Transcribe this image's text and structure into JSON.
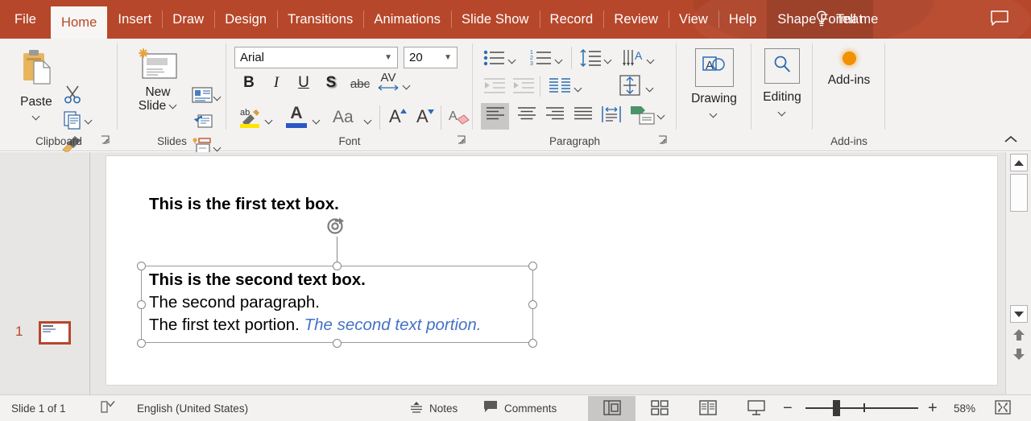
{
  "titlebar": {
    "tabs": [
      {
        "label": "File",
        "state": "file"
      },
      {
        "label": "Home",
        "state": "active"
      },
      {
        "label": "Insert",
        "state": "normal"
      },
      {
        "label": "Draw",
        "state": "normal"
      },
      {
        "label": "Design",
        "state": "normal"
      },
      {
        "label": "Transitions",
        "state": "normal"
      },
      {
        "label": "Animations",
        "state": "normal"
      },
      {
        "label": "Slide Show",
        "state": "normal"
      },
      {
        "label": "Record",
        "state": "normal"
      },
      {
        "label": "Review",
        "state": "normal"
      },
      {
        "label": "View",
        "state": "normal"
      },
      {
        "label": "Help",
        "state": "normal"
      },
      {
        "label": "Shape Format",
        "state": "contextual"
      }
    ],
    "tellme_label": "Tell me",
    "bulb_icon": "lightbulb-icon",
    "comments_icon": "comment-bubble-icon",
    "accent_color": "#b7472a"
  },
  "ribbon": {
    "groups": [
      {
        "name": "Clipboard",
        "title": "Clipboard"
      },
      {
        "name": "Slides",
        "title": "Slides"
      },
      {
        "name": "Font",
        "title": "Font"
      },
      {
        "name": "Paragraph",
        "title": "Paragraph"
      },
      {
        "name": "Drawing",
        "title": "Drawing"
      },
      {
        "name": "Editing",
        "title": "Editing"
      },
      {
        "name": "Add-ins",
        "title": "Add-ins"
      }
    ],
    "clipboard": {
      "paste_label": "Paste",
      "cut_icon": "scissors-icon",
      "copy_icon": "copy-icon",
      "format_painter_icon": "format-painter-icon"
    },
    "slides": {
      "new_slide_label": "New\nSlide",
      "new_slide_line1": "New",
      "new_slide_line2": "Slide",
      "layout_icon": "slide-layout-icon",
      "reset_icon": "reset-slide-icon",
      "section_icon": "section-icon"
    },
    "font": {
      "font_name": "Arial",
      "font_size": "20",
      "bold_label": "B",
      "italic_label": "I",
      "underline_label": "U",
      "shadow_label": "S",
      "strike_label": "abc",
      "spacing_label": "AV",
      "highlight_label": "ab",
      "fontcolor_label": "A",
      "changecase_label": "Aa",
      "grow_label": "A",
      "shrink_label": "A",
      "clearformat_label": "A"
    },
    "paragraph": {
      "bullets_icon": "bulleted-list-icon",
      "numbering_icon": "numbered-list-icon",
      "linespacing_icon": "line-spacing-icon",
      "textdirection_icon": "text-direction-icon",
      "decrease_indent_icon": "decrease-indent-icon",
      "increase_indent_icon": "increase-indent-icon",
      "columns_icon": "columns-icon",
      "align_text_icon": "align-text-vertical-icon",
      "align_left_icon": "align-left-icon",
      "align_center_icon": "align-center-icon",
      "align_right_icon": "align-right-icon",
      "justify_icon": "justify-icon",
      "text_fit_icon": "text-fit-icon",
      "smartart_icon": "convert-to-smartart-icon",
      "active_alignment": "align-left"
    },
    "drawing": {
      "label": "Drawing",
      "icon": "drawing-shapes-icon"
    },
    "editing": {
      "label": "Editing",
      "icon": "magnifier-icon"
    },
    "addins": {
      "label": "Add-ins",
      "icon": "addins-dot-icon"
    },
    "collapse_icon": "collapse-ribbon-chevron-icon"
  },
  "thumbnails": {
    "slides": [
      {
        "number": "1",
        "selected": true
      }
    ]
  },
  "slide": {
    "textbox1": {
      "text": "This is the first text box.",
      "bold": true
    },
    "textbox2": {
      "selected": true,
      "lines": [
        {
          "text": "This is the second text box.",
          "style": "bold"
        },
        {
          "text": "The second paragraph.",
          "style": "normal"
        }
      ],
      "line3_part1": "The first text portion. ",
      "line3_part2": "The second text portion.",
      "line3_part2_color": "#4472c4"
    },
    "rotate_handle_icon": "rotate-handle-icon"
  },
  "scrollbar": {
    "up_icon": "scroll-up-arrow-icon",
    "down_icon": "scroll-down-arrow-icon",
    "prev_slide_icon": "previous-slide-icon",
    "next_slide_icon": "next-slide-icon"
  },
  "statusbar": {
    "slide_count": "Slide 1 of 1",
    "spellcheck_icon": "spellcheck-icon",
    "language": "English (United States)",
    "notes_label": "Notes",
    "notes_icon": "notes-icon",
    "comments_label": "Comments",
    "comments_icon": "comments-icon",
    "views": [
      {
        "name": "normal-view",
        "icon": "normal-view-icon",
        "active": true
      },
      {
        "name": "slide-sorter-view",
        "icon": "slide-sorter-icon",
        "active": false
      },
      {
        "name": "reading-view",
        "icon": "reading-view-icon",
        "active": false
      },
      {
        "name": "slideshow-view",
        "icon": "slideshow-icon",
        "active": false
      }
    ],
    "zoom_out_label": "−",
    "zoom_in_label": "+",
    "zoom_level": "58%",
    "fit_slide_icon": "fit-slide-to-window-icon"
  }
}
